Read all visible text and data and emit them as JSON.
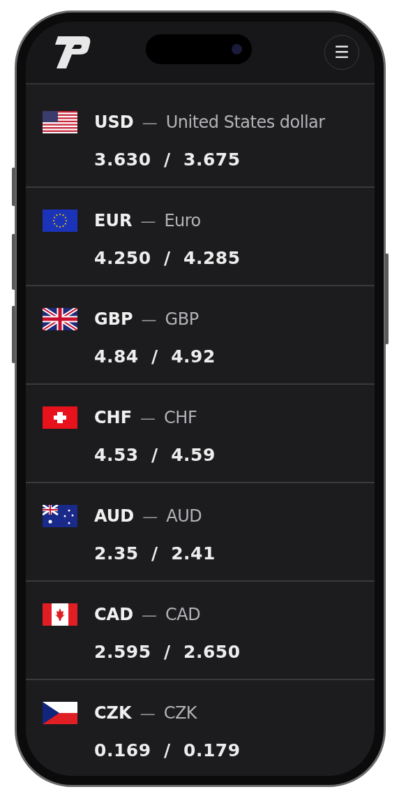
{
  "header": {
    "menu_button": "☰"
  },
  "currencies": [
    {
      "code": "USD",
      "dash": "—",
      "name": "United States dollar",
      "rate": "3.630  /  3.675"
    },
    {
      "code": "EUR",
      "dash": "—",
      "name": "Euro",
      "rate": "4.250  /  4.285"
    },
    {
      "code": "GBP",
      "dash": "—",
      "name": "GBP",
      "rate": "4.84  /  4.92"
    },
    {
      "code": "CHF",
      "dash": "—",
      "name": "CHF",
      "rate": "4.53  /  4.59"
    },
    {
      "code": "AUD",
      "dash": "—",
      "name": "AUD",
      "rate": "2.35  /  2.41"
    },
    {
      "code": "CAD",
      "dash": "—",
      "name": "CAD",
      "rate": "2.595  /  2.650"
    },
    {
      "code": "CZK",
      "dash": "—",
      "name": "CZK",
      "rate": "0.169  /  0.179"
    }
  ]
}
